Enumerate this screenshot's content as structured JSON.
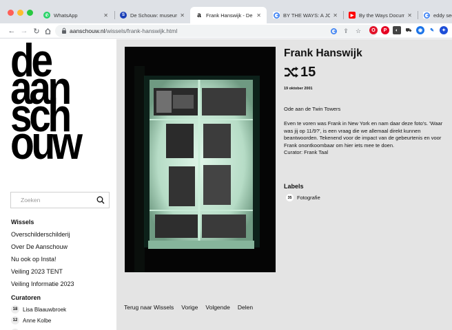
{
  "browser": {
    "tabs": [
      {
        "title": "WhatsApp",
        "favicon": "whatsapp-icon",
        "color": "#25d366",
        "active": false
      },
      {
        "title": "De Schouw: museum v",
        "favicon": "site-icon",
        "color": "#1a3fb8",
        "active": false
      },
      {
        "title": "Frank Hanswijk - De A",
        "favicon": "aanschouw-icon",
        "color": "#000000",
        "active": true
      },
      {
        "title": "BY THE WAYS: A JOUR",
        "favicon": "google-icon",
        "color": "#4285f4",
        "active": false
      },
      {
        "title": "By the Ways Documen",
        "favicon": "youtube-icon",
        "color": "#ff0000",
        "active": false
      },
      {
        "title": "eddy sees",
        "favicon": "google-icon",
        "color": "#4285f4",
        "active": false
      }
    ],
    "url_host": "aanschouw.nl",
    "url_path": "/wissels/frank-hanswijk.html"
  },
  "sidebar": {
    "logo_lines": [
      "de",
      "aan",
      "sch",
      "ouw"
    ],
    "search_placeholder": "Zoeken",
    "wissels_heading": "Wissels",
    "menu": [
      "Overschilderschilderij",
      "Over De Aanschouw",
      "Nu ook op Insta!",
      "Veiling 2023 TENT",
      "Veiling Informatie 2023"
    ],
    "curators_heading": "Curatoren",
    "curators": [
      {
        "count": "18",
        "name": "Lisa Blaauwbroek"
      },
      {
        "count": "12",
        "name": "Anne Kolbe"
      }
    ]
  },
  "article": {
    "title": "Frank Hanswijk",
    "number": "15",
    "date": "19 oktober 2001",
    "subtitle": "Ode aan de Twin Towers",
    "body": "Even te voren was Frank in New York en nam daar deze foto's. 'Waar was jij op 11/9?', is een vraag die we allemaal direkt kunnen beantwoorden. Tekenend voor de impact van de gebeurtenis en voor Frank onontkoombaar om hier iets mee te doen.",
    "curator": "Curator: Frank Taal",
    "labels_heading": "Labels",
    "labels": [
      {
        "count": "35",
        "name": "Fotografie"
      }
    ]
  },
  "footer": {
    "back": "Terug naar Wissels",
    "prev": "Vorige",
    "next": "Volgende",
    "share": "Delen"
  }
}
